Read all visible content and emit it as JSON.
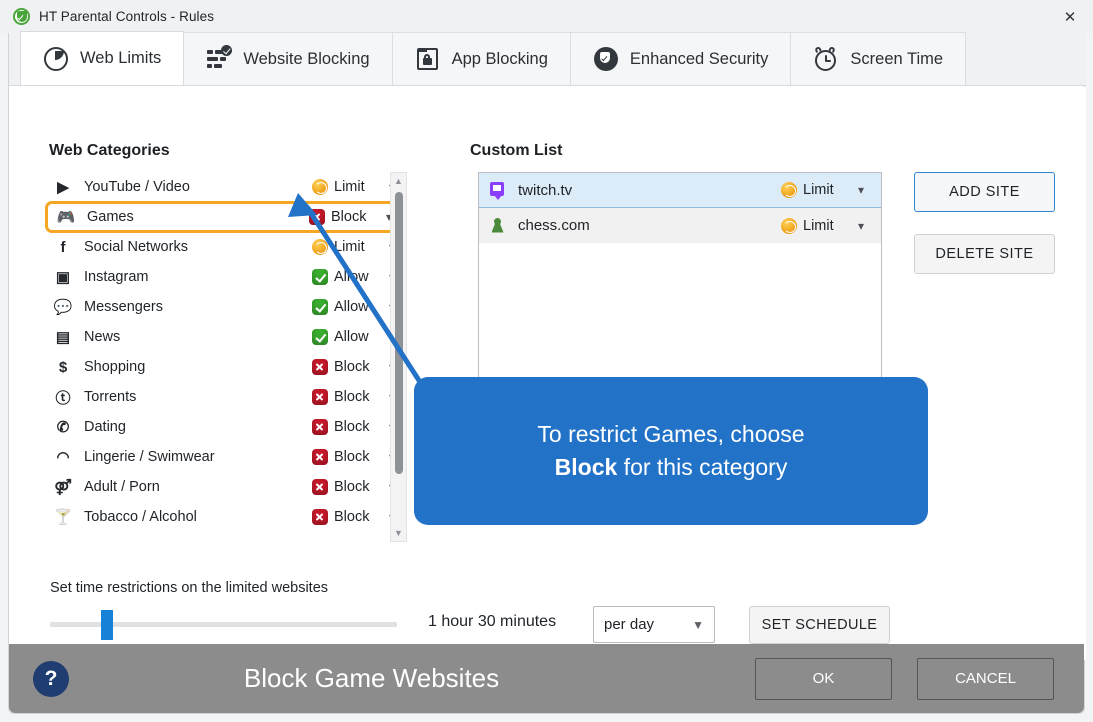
{
  "window": {
    "title": "HT Parental Controls - Rules",
    "app_icon": "shield-check-icon",
    "close_icon": "close-icon"
  },
  "tabs": [
    {
      "label": "Web Limits",
      "icon": "clock-pie-icon",
      "active": true
    },
    {
      "label": "Website Blocking",
      "icon": "list-check-icon",
      "active": false
    },
    {
      "label": "App Blocking",
      "icon": "window-lock-icon",
      "active": false
    },
    {
      "label": "Enhanced Security",
      "icon": "shield-check-icon",
      "active": false
    },
    {
      "label": "Screen Time",
      "icon": "alarm-clock-icon",
      "active": false
    }
  ],
  "categories": {
    "title": "Web Categories",
    "items": [
      {
        "name": "YouTube / Video",
        "icon": "youtube-icon",
        "status": "Limit",
        "state": "limit",
        "highlight": false
      },
      {
        "name": "Games",
        "icon": "gamepad-icon",
        "status": "Block",
        "state": "block",
        "highlight": true
      },
      {
        "name": "Social Networks",
        "icon": "facebook-icon",
        "status": "Limit",
        "state": "limit",
        "highlight": false
      },
      {
        "name": "Instagram",
        "icon": "instagram-icon",
        "status": "Allow",
        "state": "allow",
        "highlight": false
      },
      {
        "name": "Messengers",
        "icon": "chat-icon",
        "status": "Allow",
        "state": "allow",
        "highlight": false
      },
      {
        "name": "News",
        "icon": "newspaper-icon",
        "status": "Allow",
        "state": "allow",
        "highlight": false
      },
      {
        "name": "Shopping",
        "icon": "dollar-icon",
        "status": "Block",
        "state": "block",
        "highlight": false
      },
      {
        "name": "Torrents",
        "icon": "torrent-icon",
        "status": "Block",
        "state": "block",
        "highlight": false
      },
      {
        "name": "Dating",
        "icon": "phone-heart-icon",
        "status": "Block",
        "state": "block",
        "highlight": false
      },
      {
        "name": "Lingerie / Swimwear",
        "icon": "bra-icon",
        "status": "Block",
        "state": "block",
        "highlight": false
      },
      {
        "name": "Adult / Porn",
        "icon": "adult-icon",
        "status": "Block",
        "state": "block",
        "highlight": false
      },
      {
        "name": "Tobacco / Alcohol",
        "icon": "cocktail-icon",
        "status": "Block",
        "state": "block",
        "highlight": false
      }
    ],
    "scrollbar": {
      "up_icon": "scroll-up-arrow",
      "down_icon": "scroll-down-arrow"
    }
  },
  "custom_list": {
    "title": "Custom List",
    "items": [
      {
        "name": "twitch.tv",
        "icon": "twitch-icon",
        "status": "Limit",
        "selected": true
      },
      {
        "name": "chess.com",
        "icon": "chess-pawn-icon",
        "status": "Limit",
        "selected": false
      }
    ],
    "add_button": "ADD SITE",
    "delete_button": "DELETE SITE"
  },
  "callout": {
    "line1": "To restrict Games, choose",
    "line2_bold": "Block",
    "line2_rest": " for this category",
    "color": "#2272c8"
  },
  "time_restrictions": {
    "label": "Set time restrictions on the limited websites",
    "slider_value_percent": 15,
    "duration": "1 hour 30 minutes",
    "period": "per day",
    "period_caret": "chevron-down-icon",
    "schedule_button": "SET SCHEDULE"
  },
  "footer": {
    "help_label": "?",
    "title": "Block Game Websites",
    "ok_label": "OK",
    "cancel_label": "CANCEL",
    "background": "#8c8c8c"
  },
  "colors": {
    "accent_blue": "#2272c8",
    "highlight_orange": "#f5a623",
    "block_red": "#c5182b",
    "allow_green": "#3aac2f",
    "limit_amber": "#f0a21a"
  }
}
